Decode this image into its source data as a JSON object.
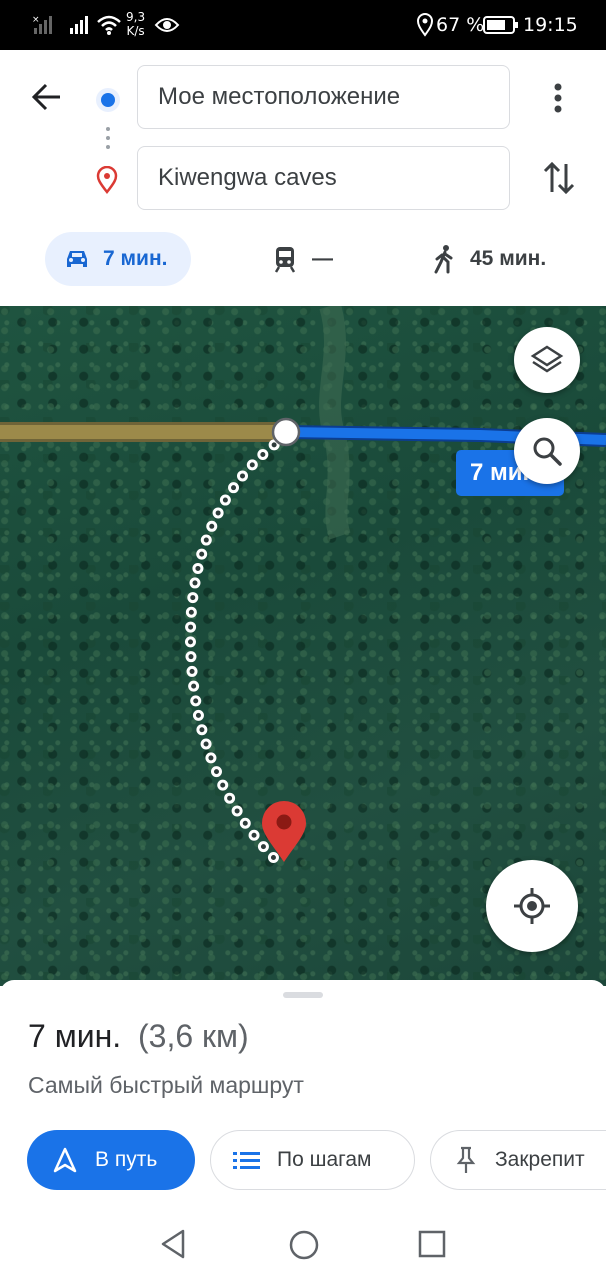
{
  "status_bar": {
    "net_speed_value": "9,3",
    "net_speed_unit": "K/s",
    "battery": "67 %",
    "time": "19:15"
  },
  "directions": {
    "origin": "Мое местоположение",
    "destination": "Kiwengwa caves"
  },
  "modes": {
    "drive": "7 мин.",
    "transit": "—",
    "walk": "45 мин."
  },
  "map": {
    "route_label": "7 мин"
  },
  "sheet": {
    "duration": "7 мин.",
    "distance": "(3,6 км)",
    "subtitle": "Самый быстрый маршрут",
    "start_button": "В путь",
    "steps_button": "По шагам",
    "pin_button": "Закрепит"
  },
  "colors": {
    "accent": "#1a73e8",
    "route_blue": "#1967d2",
    "selected_mode_bg": "#e8f0fe",
    "pin_red": "#db3a34",
    "unpaved_road": "#9c8a4a"
  }
}
